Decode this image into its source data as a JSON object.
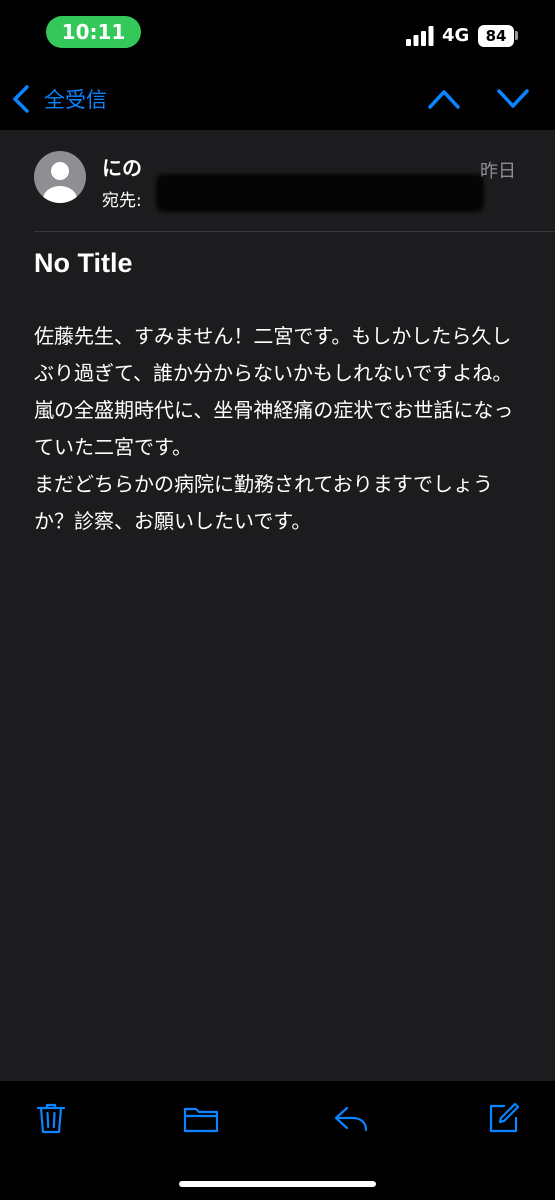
{
  "status_bar": {
    "time": "10:11",
    "network": "4G",
    "battery": "84"
  },
  "nav": {
    "back_label": "全受信"
  },
  "message": {
    "sender": "にの",
    "to_label": "宛先:",
    "date": "昨日",
    "subject": "No Title",
    "body": "佐藤先生、すみません！二宮です。もしかしたら久しぶり過ぎて、誰か分からないかもしれないですよね。嵐の全盛期時代に、坐骨神経痛の症状でお世話になっていた二宮です。\nまだどちらかの病院に勤務されておりますでしょうか？診察、お願いしたいです。"
  },
  "icons": {
    "back": "chevron-left-icon",
    "previous": "chevron-up-icon",
    "next": "chevron-down-icon",
    "trash": "trash-icon",
    "folder": "folder-icon",
    "reply": "reply-icon",
    "compose": "compose-icon"
  },
  "colors": {
    "accent": "#0a84ff",
    "time_pill": "#34c759",
    "background": "#1c1c1e",
    "bars": "#000000",
    "secondary_text": "#8e8e93"
  }
}
